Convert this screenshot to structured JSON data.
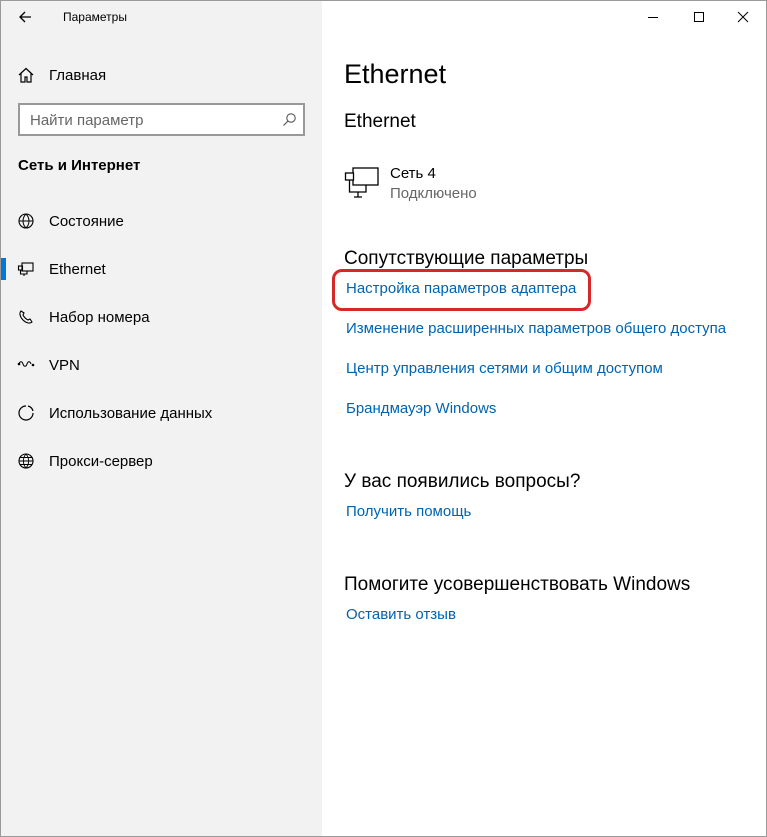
{
  "app": {
    "title": "Параметры"
  },
  "sidebar": {
    "home_label": "Главная",
    "search_placeholder": "Найти параметр",
    "section_title": "Сеть и Интернет",
    "items": [
      {
        "label": "Состояние",
        "icon": "globe-status-icon",
        "active": false
      },
      {
        "label": "Ethernet",
        "icon": "ethernet-icon",
        "active": true
      },
      {
        "label": "Набор номера",
        "icon": "dialup-icon",
        "active": false
      },
      {
        "label": "VPN",
        "icon": "vpn-icon",
        "active": false
      },
      {
        "label": "Использование данных",
        "icon": "data-usage-icon",
        "active": false
      },
      {
        "label": "Прокси-сервер",
        "icon": "globe-icon",
        "active": false
      }
    ]
  },
  "main": {
    "title": "Ethernet",
    "subtitle": "Ethernet",
    "network": {
      "name": "Сеть 4",
      "status": "Подключено"
    },
    "related": {
      "title": "Сопутствующие параметры",
      "links": [
        "Настройка параметров адаптера",
        "Изменение расширенных параметров общего доступа",
        "Центр управления сетями и общим доступом",
        "Брандмауэр Windows"
      ]
    },
    "questions": {
      "title": "У вас появились вопросы?",
      "link": "Получить помощь"
    },
    "improve": {
      "title": "Помогите усовершенствовать Windows",
      "link": "Оставить отзыв"
    }
  },
  "colors": {
    "accent": "#0078d7",
    "link": "#0063b1",
    "highlight": "#d62828",
    "sidebar_bg": "#f2f2f2"
  }
}
